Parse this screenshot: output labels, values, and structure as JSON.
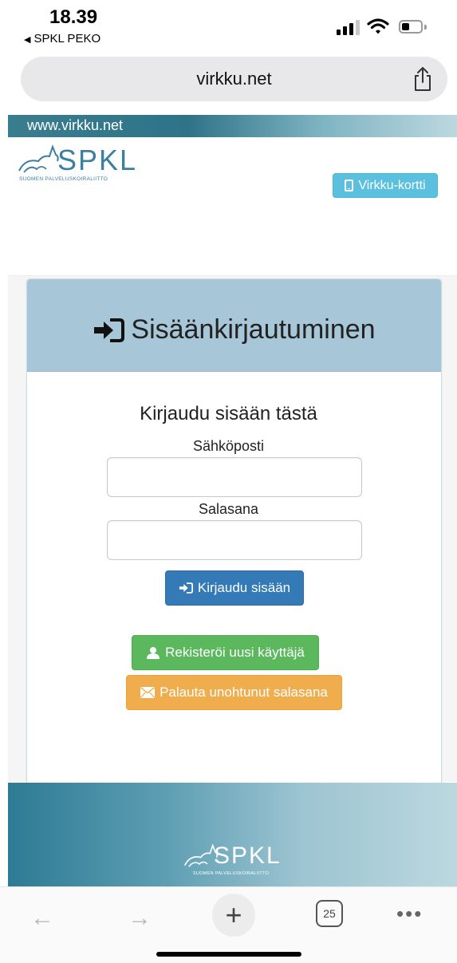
{
  "status_bar": {
    "time": "18.39",
    "back_app": "SPKL PEKO"
  },
  "browser": {
    "url": "virkku.net",
    "share_icon": "share-icon",
    "toolbar": {
      "back_icon": "arrow-left-icon",
      "forward_icon": "arrow-right-icon",
      "new_tab_icon": "plus-icon",
      "tab_count": "25",
      "more_icon": "more-icon"
    }
  },
  "site": {
    "banner_text": "www.virkku.net",
    "logo_text": "SPKL",
    "logo_subtitle": "SUOMEN PALVELUSKOIRALIITTO",
    "card_button": "Virkku-kortti"
  },
  "login": {
    "title": "Sisäänkirjautuminen",
    "subtitle": "Kirjaudu sisään tästä",
    "email_label": "Sähköposti",
    "email_value": "",
    "password_label": "Salasana",
    "password_value": "",
    "login_button": "Kirjaudu sisään",
    "register_button": "Rekisteröi uusi käyttäjä",
    "reset_button": "Palauta unohtunut salasana"
  },
  "footer": {
    "logo_text": "SPKL",
    "logo_subtitle": "SUOMEN PALVELUSKOIRALIITTO"
  },
  "colors": {
    "panel_header": "#a7c7d9",
    "login_button": "#337ab7",
    "register_button": "#5cb85c",
    "reset_button": "#f0ad4e",
    "card_button": "#5bc0de",
    "logo": "#3b7fa3"
  }
}
